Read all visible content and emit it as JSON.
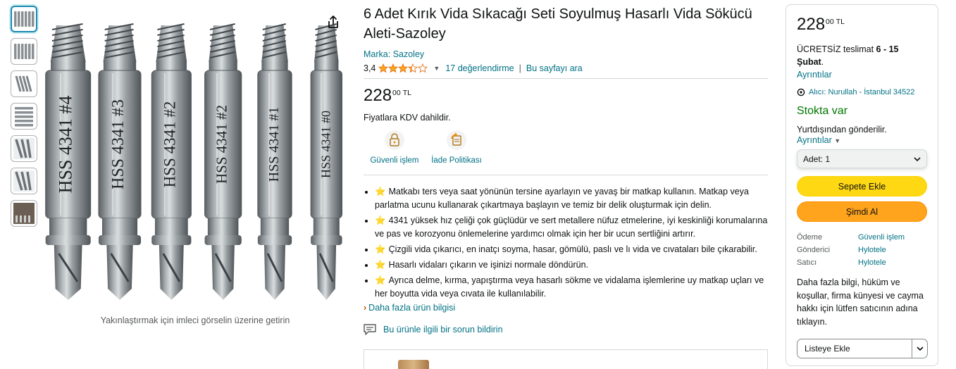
{
  "gallery": {
    "thumbnails": [
      "thumb-1",
      "thumb-2",
      "thumb-3",
      "thumb-4",
      "thumb-5",
      "thumb-6",
      "thumb-7"
    ],
    "bits": [
      {
        "label": "HSS 4341 #4"
      },
      {
        "label": "HSS 4341 #3"
      },
      {
        "label": "HSS 4341 #2"
      },
      {
        "label": "HSS 4341 #2"
      },
      {
        "label": "HSS 4341 #1"
      },
      {
        "label": "HSS 4341 #0"
      }
    ],
    "zoom_hint": "Yakınlaştırmak için imleci görselin üzerine getirin"
  },
  "product": {
    "title": "6 Adet Kırık Vida Sıkacağı Seti Soyulmuş Hasarlı Vida Sökücü Aleti-Sazoley",
    "brand": "Marka: Sazoley",
    "rating_value": "3,4",
    "rating": 3.4,
    "reviews": "17 değerlendirme",
    "search_page": "Bu sayfayı ara",
    "separator": "|",
    "price_whole": "228",
    "price_fraction": "00",
    "currency": "TL",
    "vat_note": "Fiyatlara KDV dahildir.",
    "badges": [
      {
        "label": "Güvenli işlem",
        "icon": "lock-icon"
      },
      {
        "label": "İade Politikası",
        "icon": "return-icon"
      }
    ],
    "bullets": [
      "Matkabı ters veya saat yönünün tersine ayarlayın ve yavaş bir matkap kullanın. Matkap veya parlatma ucunu kullanarak çıkartmaya başlayın ve temiz bir delik oluşturmak için delin.",
      "4341 yüksek hız çeliği çok güçlüdür ve sert metallere nüfuz etmelerine, iyi keskinliği korumalarına ve pas ve korozyonu önlemelerine yardımcı olmak için her bir ucun sertliğini artırır.",
      "Çizgili vida çıkarıcı, en inatçı soyma, hasar, gömülü, paslı ve lı vida ve cıvataları bile çıkarabilir.",
      "Hasarlı vidaları çıkarın ve işinizi normale döndürün.",
      "Ayrıca delme, kırma, yapıştırma veya hasarlı sökme ve vidalama işlemlerine uy matkap uçları ve her boyutta vida veya cıvata ile kullanılabilir."
    ],
    "more_info": "Daha fazla ürün bilgisi",
    "report_issue": "Bu ürünle ilgili bir sorun bildirin"
  },
  "buybox": {
    "price_whole": "228",
    "price_fraction": "00",
    "currency": "TL",
    "delivery_prefix": "ÜCRETSİZ teslimat ",
    "delivery_dates": "6 - 15 Şubat",
    "delivery_suffix": ".",
    "details_link": "Ayrıntılar",
    "deliver_to": "Alıcı: Nurullah - İstanbul 34522",
    "stock": "Stokta var",
    "ships_from_abroad": "Yurtdışından gönderilir.",
    "details_link_2": "Ayrıntılar",
    "quantity": "Adet:  1",
    "add_to_cart": "Sepete Ekle",
    "buy_now": "Şimdi Al",
    "meta": [
      {
        "key": "Ödeme",
        "value": "Güvenli işlem"
      },
      {
        "key": "Gönderici",
        "value": "Hylotele"
      },
      {
        "key": "Satıcı",
        "value": "Hylotele"
      }
    ],
    "more_info_text": "Daha fazla bilgi, hüküm ve koşullar, firma künyesi ve cayma hakkı için lütfen satıcının adına tıklayın.",
    "add_to_list": "Listeye Ekle"
  },
  "colors": {
    "link": "#007185",
    "star": "#ffa41c",
    "cart_button": "#ffd814",
    "buy_button": "#ffa41c",
    "in_stock": "#007600"
  }
}
